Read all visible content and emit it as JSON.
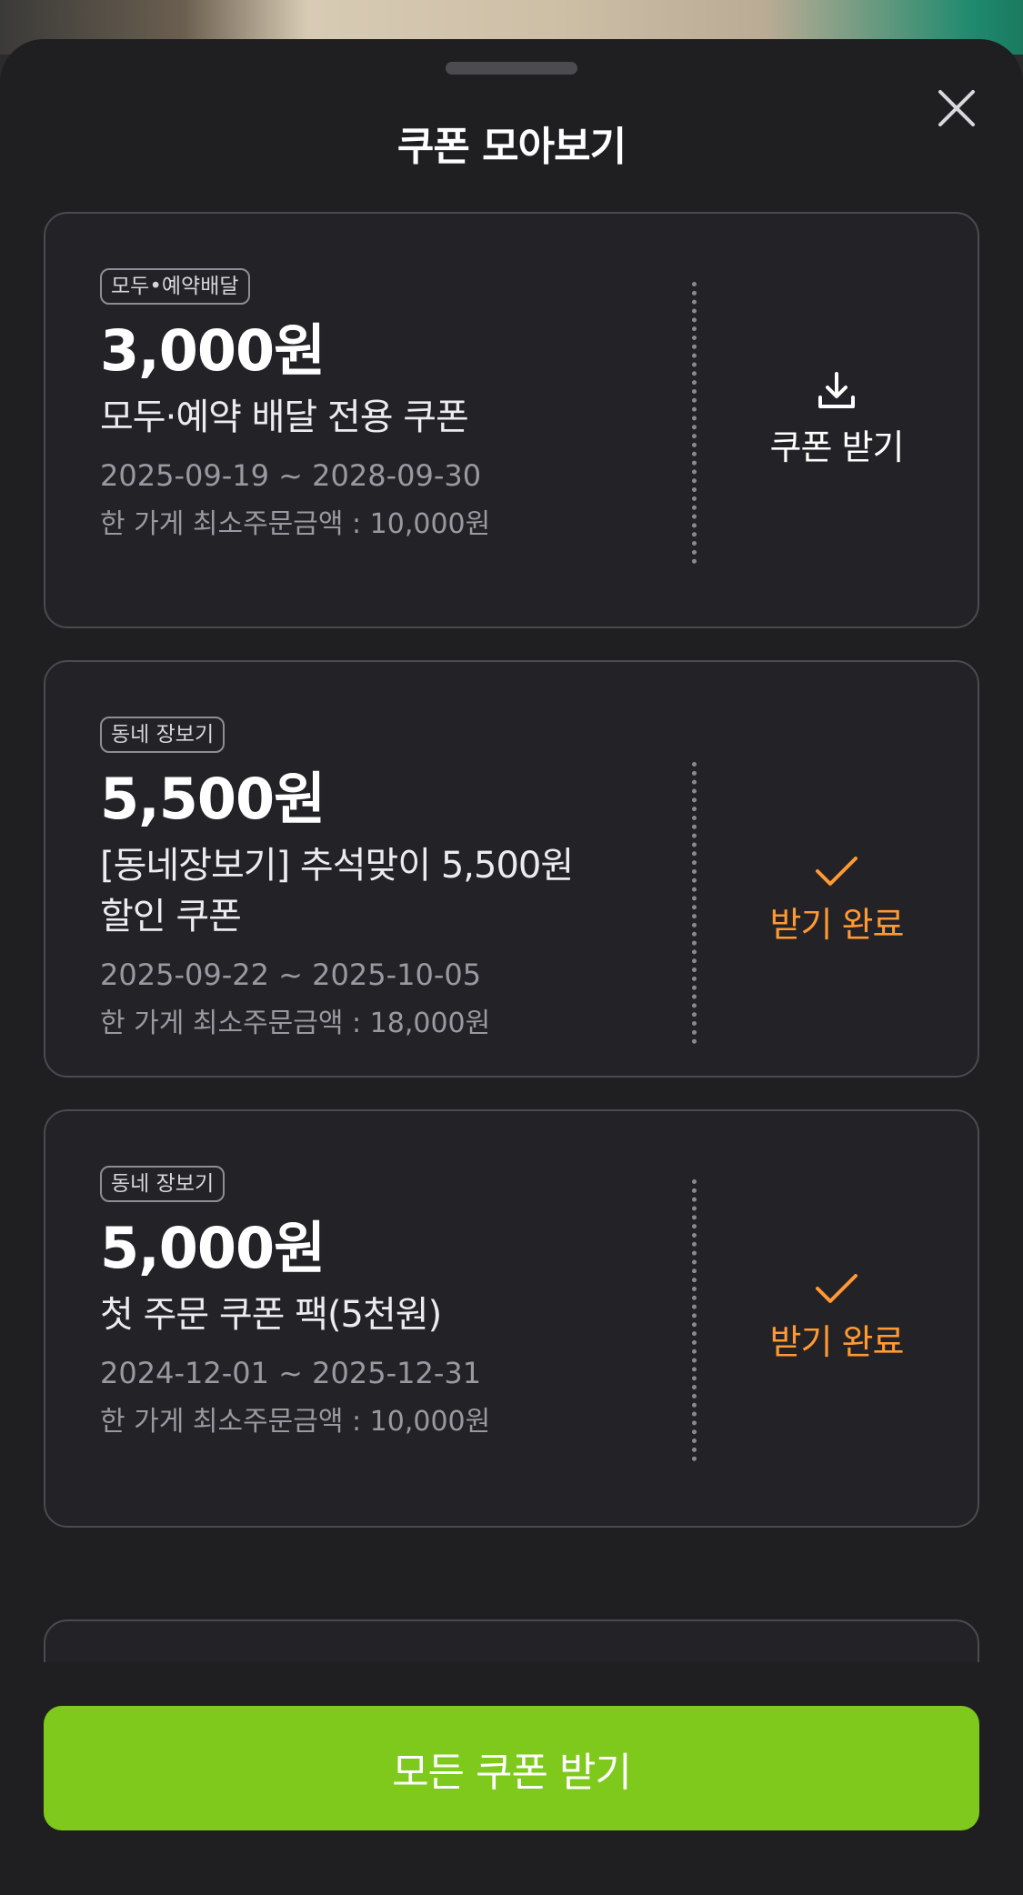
{
  "sheet": {
    "title": "쿠폰 모아보기",
    "close_icon": "close-icon"
  },
  "coupons": [
    {
      "tag": "모두•예약배달",
      "amount": "3,000원",
      "name": "모두·예약 배달 전용 쿠폰",
      "period": "2025-09-19 ~ 2028-09-30",
      "min_order": "한 가게 최소주문금액 : 10,000원",
      "action_label": "쿠폰 받기",
      "action_icon": "download-icon",
      "status": "available"
    },
    {
      "tag": "동네 장보기",
      "amount": "5,500원",
      "name": "[동네장보기] 추석맞이 5,500원 할인 쿠폰",
      "period": "2025-09-22 ~ 2025-10-05",
      "min_order": "한 가게 최소주문금액 : 18,000원",
      "action_label": "받기 완료",
      "action_icon": "check-icon",
      "status": "received"
    },
    {
      "tag": "동네 장보기",
      "amount": "5,000원",
      "name": "첫 주문 쿠폰 팩(5천원)",
      "period": "2024-12-01 ~ 2025-12-31",
      "min_order": "한 가게 최소주문금액 : 10,000원",
      "action_label": "받기 완료",
      "action_icon": "check-icon",
      "status": "received"
    }
  ],
  "footer": {
    "get_all_label": "모든 쿠폰 받기"
  },
  "colors": {
    "accent_green": "#7ec91c",
    "received_orange": "#ff9933",
    "sheet_bg": "#1f1e21"
  }
}
